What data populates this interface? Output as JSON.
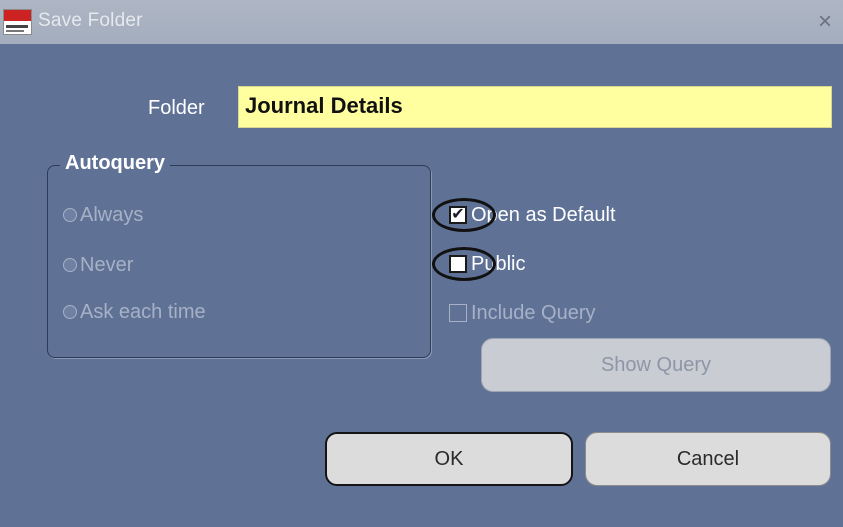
{
  "window": {
    "title": "Save Folder",
    "close_label": "×"
  },
  "folder": {
    "label": "Folder",
    "value": "Journal Details"
  },
  "autoquery": {
    "legend": "Autoquery",
    "options": [
      {
        "label": "Always",
        "selected": false,
        "enabled": false
      },
      {
        "label": "Never",
        "selected": false,
        "enabled": false
      },
      {
        "label": "Ask each time",
        "selected": false,
        "enabled": false
      }
    ]
  },
  "checkboxes": {
    "open_as_default": {
      "label": "Open as Default",
      "checked": true,
      "enabled": true
    },
    "public": {
      "label": "Public",
      "checked": false,
      "enabled": true
    },
    "include_query": {
      "label": "Include Query",
      "checked": false,
      "enabled": false
    }
  },
  "buttons": {
    "show_query": "Show Query",
    "ok": "OK",
    "cancel": "Cancel"
  },
  "colors": {
    "window_bg": "#5f7296",
    "input_bg": "#ffffa0",
    "titlebar": "#a3adbd"
  }
}
